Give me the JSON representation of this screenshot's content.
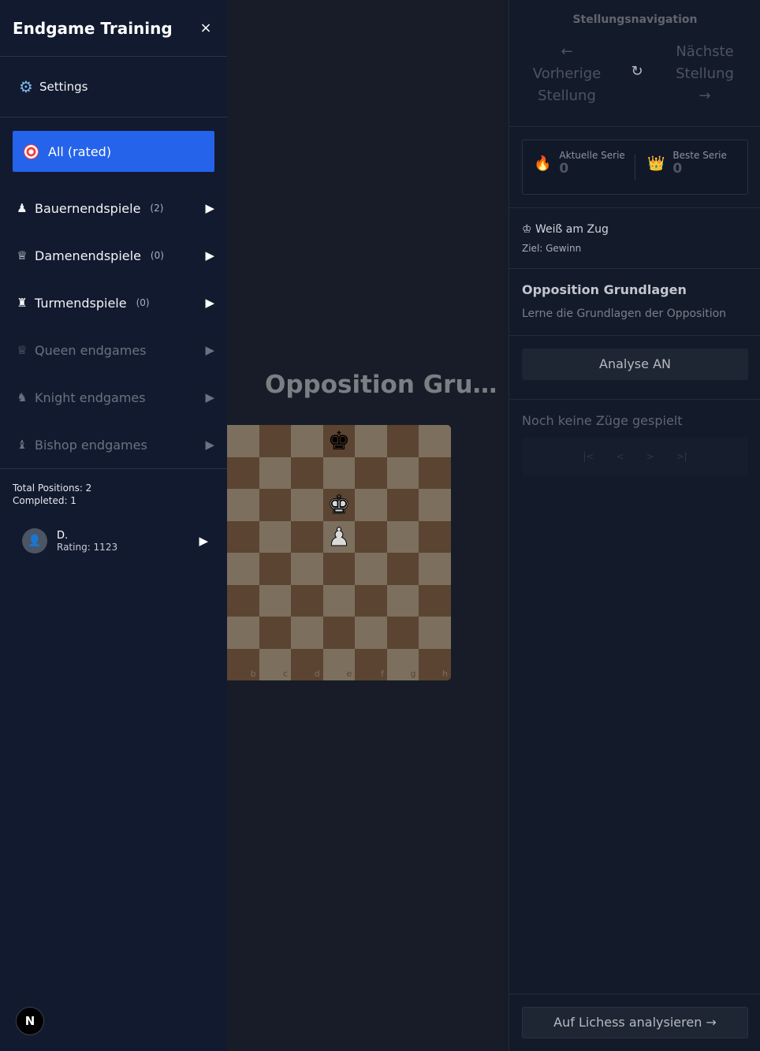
{
  "sidebar": {
    "title": "Endgame Training",
    "close_icon": "×",
    "settings_label": "Settings",
    "all_label": "All (rated)",
    "categories": [
      {
        "icon": "♟",
        "label": "Bauernendspiele",
        "count": "(2)",
        "arrow": "▶"
      },
      {
        "icon": "♕",
        "label": "Damenendspiele",
        "count": "(0)",
        "arrow": "▶"
      },
      {
        "icon": "♜",
        "label": "Turmendspiele",
        "count": "(0)",
        "arrow": "▶"
      },
      {
        "icon": "♕",
        "label": "Queen endgames",
        "arrow": "▶"
      },
      {
        "icon": "♞",
        "label": "Knight endgames",
        "arrow": "▶"
      },
      {
        "icon": "♝",
        "label": "Bishop endgames",
        "arrow": "▶"
      }
    ],
    "stats": {
      "total": "Total Positions: 2",
      "completed": "Completed: 1"
    },
    "user": {
      "name": "D.",
      "rating": "Rating: 1123",
      "arrow": "▶"
    },
    "badge": "N"
  },
  "main": {
    "title": "Opposition Grundlagen",
    "board": {
      "files": [
        "b",
        "c",
        "d",
        "e",
        "f",
        "g",
        "h"
      ],
      "pieces": [
        {
          "glyph": "♚",
          "color": "black",
          "file": "e",
          "rank": 8
        },
        {
          "glyph": "♚",
          "color": "white",
          "file": "e",
          "rank": 6
        },
        {
          "glyph": "♟",
          "color": "white",
          "file": "e",
          "rank": 5
        }
      ]
    }
  },
  "panel": {
    "nav_title": "Stellungsnavigation",
    "prev_arrow": "←",
    "prev_label": "Vorherige Stellung",
    "reset_icon": "↻",
    "next_label": "Nächste Stellung",
    "next_arrow": "→",
    "current_streak_label": "Aktuelle Serie",
    "current_streak_value": "0",
    "best_streak_label": "Beste Serie",
    "best_streak_value": "0",
    "turn_icon": "♔",
    "turn_text": "Weiß am Zug",
    "goal_text": "Ziel: Gewinn",
    "position_title": "Opposition Grundlagen",
    "position_desc": "Lerne die Grundlagen der Opposition",
    "analyse_label": "Analyse AN",
    "no_moves": "Noch keine Züge gespielt",
    "move_nav": [
      "|<",
      "<",
      ">",
      ">|"
    ],
    "lichess_label": "Auf Lichess analysieren →"
  },
  "colors": {
    "accent": "#2563eb",
    "board_dark": "#5b4432",
    "board_light": "#7c6f5e"
  }
}
